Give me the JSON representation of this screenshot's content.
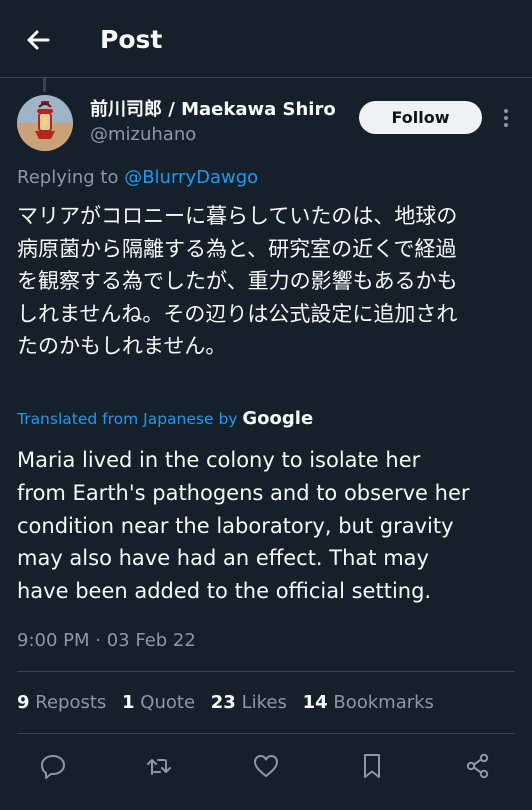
{
  "header": {
    "title": "Post",
    "back_icon": "arrow-left-icon"
  },
  "author": {
    "name": "前川司郎 / Maekawa Shiro",
    "handle": "@mizuhano",
    "follow_label": "Follow",
    "more_icon": "more-vertical-icon"
  },
  "reply": {
    "prefix": "Replying to ",
    "mention": "@BlurryDawgo"
  },
  "post": {
    "original_lines": [
      "マリアがコロニーに暮らしていたのは、地球の",
      "病原菌から隔離する為と、研究室の近くで経過",
      "を観察する為でしたが、重力の影響もあるかも",
      "しれませんね。その辺りは公式設定に追加され",
      "たのかもしれません。"
    ],
    "translated_prefix": "Translated from Japanese by ",
    "translated_brand": "Google",
    "translation_lines": [
      "Maria lived in the colony to isolate her",
      "from Earth's pathogens and to observe her",
      "condition near the laboratory, but gravity",
      "may also have had an effect. That may",
      "have been added to the official setting."
    ],
    "timestamp": "9:00 PM · 03 Feb 22"
  },
  "stats": [
    {
      "count": "9",
      "label": "Reposts"
    },
    {
      "count": "1",
      "label": "Quote"
    },
    {
      "count": "23",
      "label": "Likes"
    },
    {
      "count": "14",
      "label": "Bookmarks"
    }
  ],
  "actions": [
    "reply-icon",
    "repost-icon",
    "like-icon",
    "bookmark-icon",
    "share-icon"
  ],
  "colors": {
    "background": "#15202b",
    "text": "#f7f9f9",
    "secondary_text": "#8b98a5",
    "accent": "#1d9bf0",
    "divider": "#38444d",
    "follow_button_bg": "#eff3f4"
  }
}
